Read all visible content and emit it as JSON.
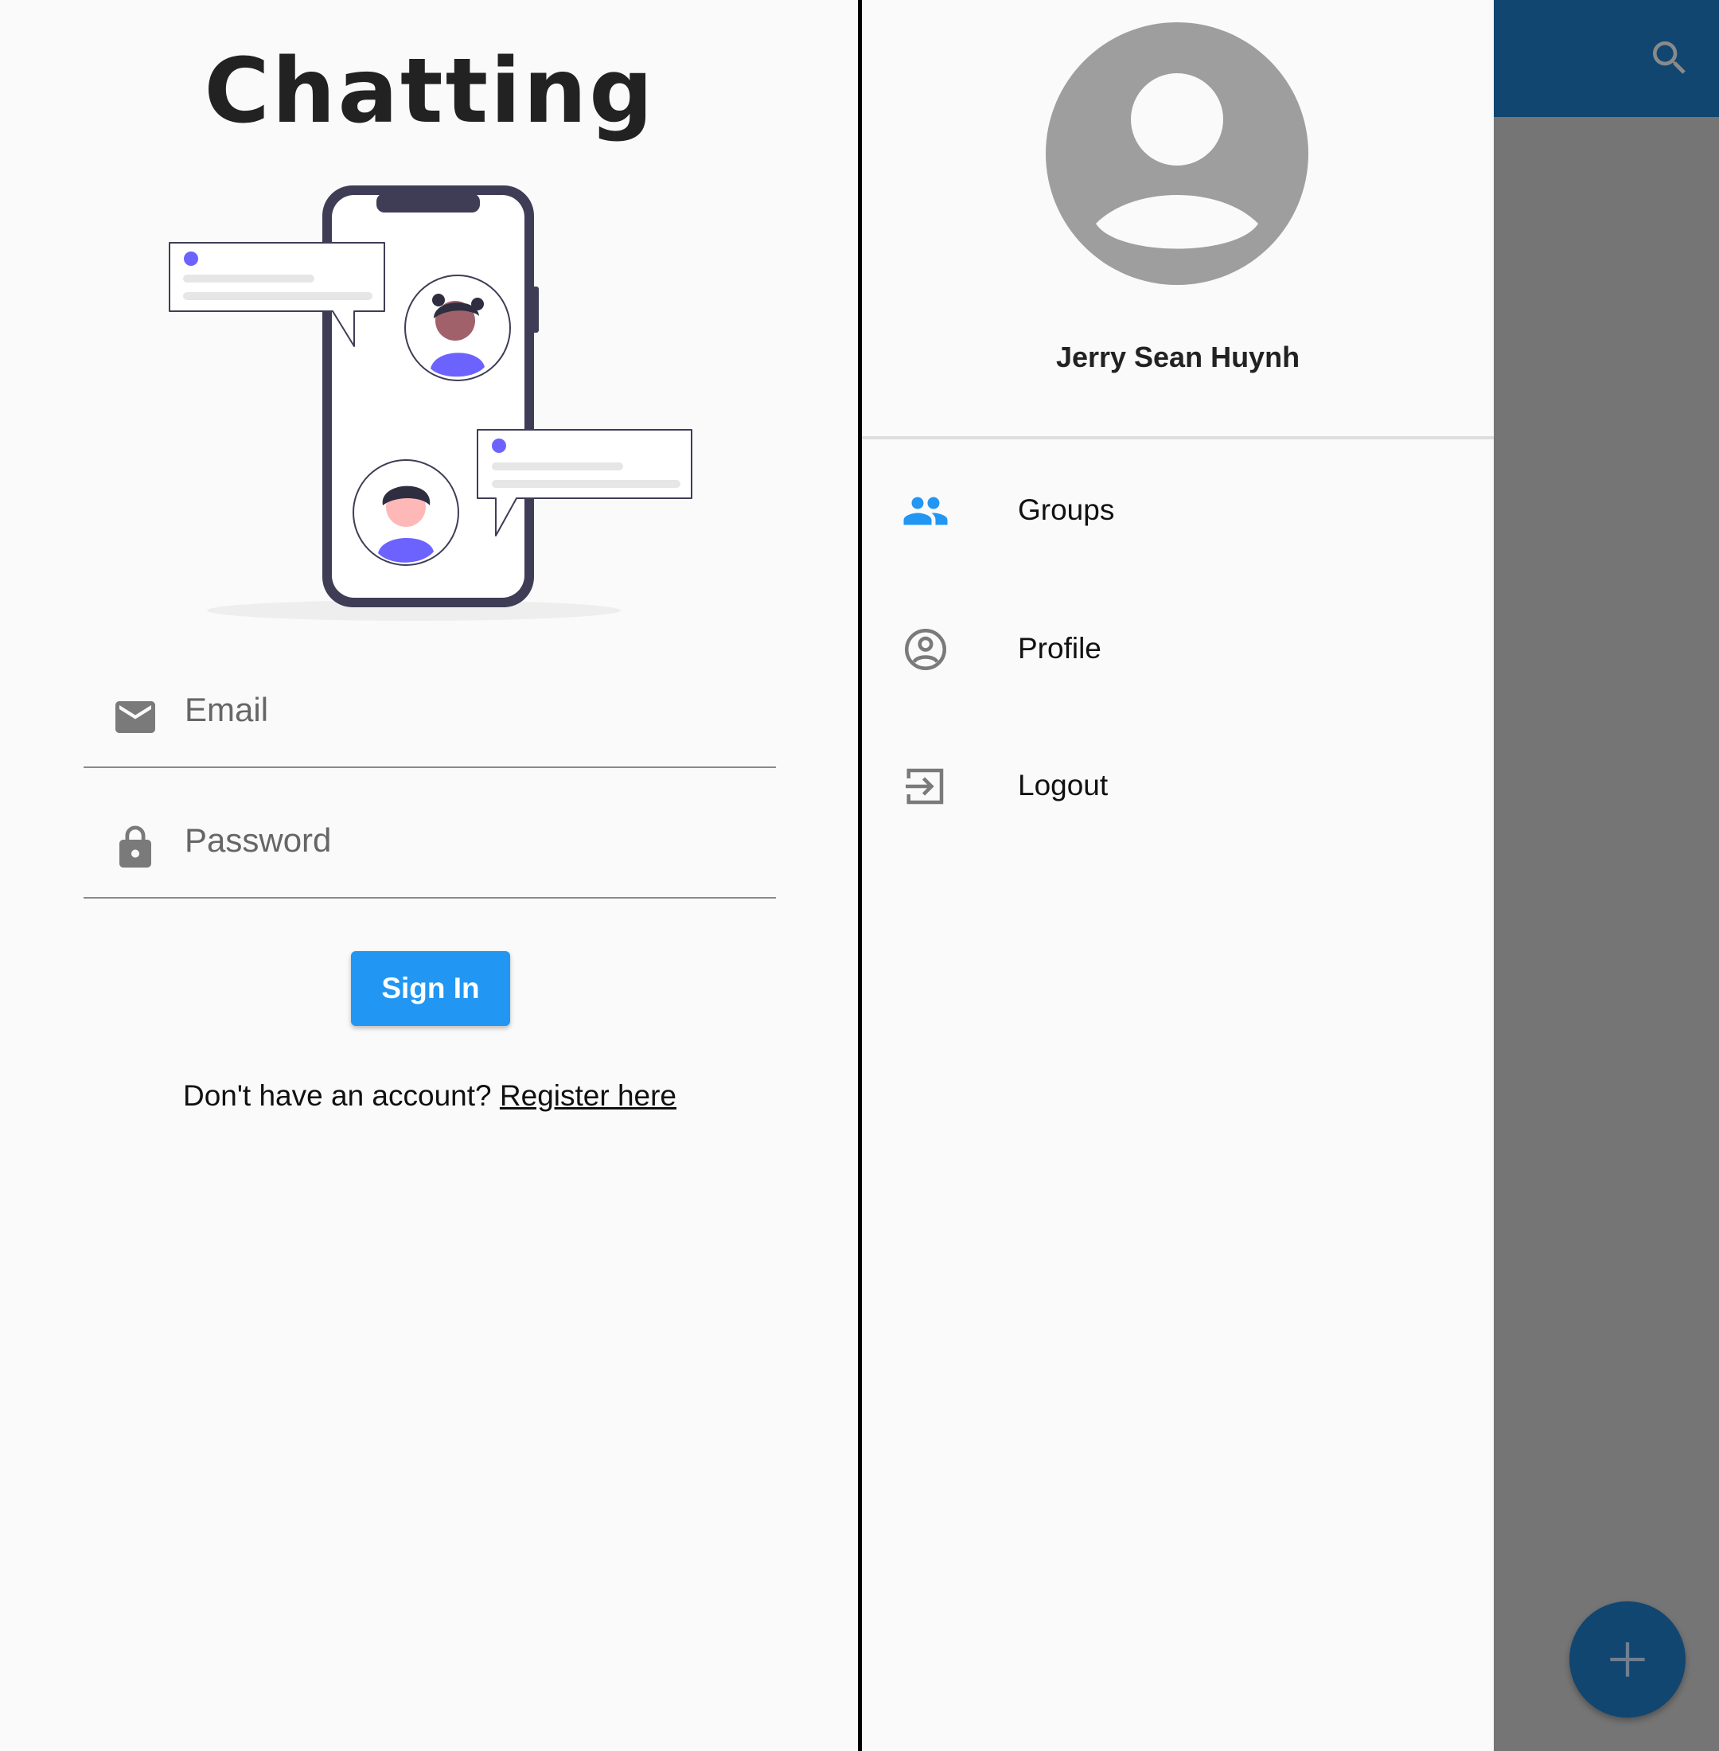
{
  "login": {
    "app_title": "Chatting",
    "email_placeholder": "Email",
    "password_placeholder": "Password",
    "signin_label": "Sign In",
    "register_prompt": "Don't have an account? ",
    "register_link": "Register here"
  },
  "drawer": {
    "user_name": "Jerry Sean Huynh",
    "menu": [
      {
        "label": "Groups",
        "icon": "groups-icon",
        "active": true
      },
      {
        "label": "Profile",
        "icon": "account-circle-icon",
        "active": false
      },
      {
        "label": "Logout",
        "icon": "logout-icon",
        "active": false
      }
    ]
  },
  "icons": {
    "email": "email-icon",
    "password": "lock-icon",
    "search": "search-icon",
    "fab": "plus-icon",
    "avatar": "person-avatar-icon"
  },
  "colors": {
    "primary": "#2196f3",
    "appbar": "#114671",
    "scrim": "#757575",
    "background": "#fafafa",
    "illustration_accent": "#6c63ff",
    "phone_frame": "#3f3d56"
  }
}
